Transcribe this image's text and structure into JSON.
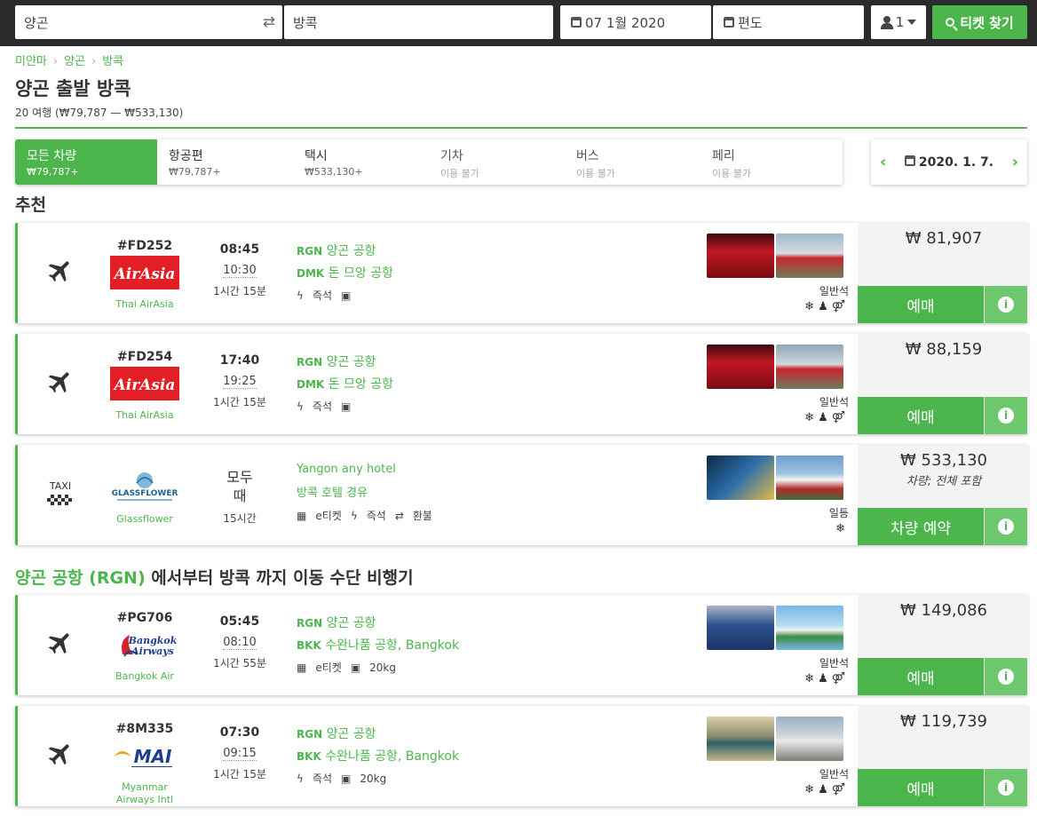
{
  "search": {
    "from": "양곤",
    "to": "방콕",
    "date": "07 1월 2020",
    "trip_type": "편도",
    "passengers": "1",
    "button_label": "티켓 찾기"
  },
  "breadcrumb": [
    "미얀마",
    "양곤",
    "방콕"
  ],
  "page_title": "양곤 출발 방콕",
  "summary": "20 여행 (₩79,787 — ₩533,130)",
  "tabs": [
    {
      "label": "모든 차량",
      "sub": "₩79,787+"
    },
    {
      "label": "항공편",
      "sub": "₩79,787+"
    },
    {
      "label": "택시",
      "sub": "₩533,130+"
    },
    {
      "label": "기차",
      "sub": "이용 불가"
    },
    {
      "label": "버스",
      "sub": "이용 불가"
    },
    {
      "label": "페리",
      "sub": "이용 불가"
    }
  ],
  "date_nav": {
    "date": "2020. 1. 7."
  },
  "sections": {
    "recommended": "추천",
    "flights_prefix": "양곤 공항 (RGN)",
    "flights_suffix": "에서부터 방콕 까지 이동 수단 비행기"
  },
  "results": [
    {
      "code": "#FD252",
      "carrier": "Thai AirAsia",
      "dep": "08:45",
      "arr": "10:30",
      "dur": "1시간 15분",
      "from_code": "RGN",
      "from": "양곤 공항",
      "to_code": "DMK",
      "to": "돈 므앙 공항",
      "feat1": "즉석",
      "feat2": "",
      "seat": "일반석",
      "price": "₩ 81,907",
      "book": "예매"
    },
    {
      "code": "#FD254",
      "carrier": "Thai AirAsia",
      "dep": "17:40",
      "arr": "19:25",
      "dur": "1시간 15분",
      "from_code": "RGN",
      "from": "양곤 공항",
      "to_code": "DMK",
      "to": "돈 므앙 공항",
      "feat1": "즉석",
      "feat2": "",
      "seat": "일반석",
      "price": "₩ 88,159",
      "book": "예매"
    },
    {
      "code": "",
      "carrier": "Glassflower",
      "dep": "모두",
      "dep2": "때",
      "dur": "15시간",
      "taxi_label": "TAXI",
      "from": "Yangon any hotel",
      "to": "방콕 호텔 경유",
      "feat0": "e티켓",
      "feat1": "즉석",
      "feat2": "환불",
      "seat": "일등",
      "price": "₩ 533,130",
      "price_note": "차량; 전체 포함",
      "book": "차량 예약"
    },
    {
      "code": "#PG706",
      "carrier": "Bangkok Air",
      "dep": "05:45",
      "arr": "08:10",
      "dur": "1시간 55분",
      "from_code": "RGN",
      "from": "양곤 공항",
      "to_code": "BKK",
      "to": "수완나품 공항, Bangkok",
      "feat0": "e티켓",
      "feat2": "20kg",
      "seat": "일반석",
      "price": "₩ 149,086",
      "book": "예매"
    },
    {
      "code": "#8M335",
      "carrier": "Myanmar Airways Intl",
      "dep": "07:30",
      "arr": "09:15",
      "dur": "1시간 15분",
      "from_code": "RGN",
      "from": "양곤 공항",
      "to_code": "BKK",
      "to": "수완나품 공항, Bangkok",
      "feat1": "즉석",
      "feat2": "20kg",
      "seat": "일반석",
      "price": "₩ 119,739",
      "book": "예매"
    }
  ],
  "colors": {
    "accent": "#4cb64c",
    "topbar": "#2b2b2b",
    "airasia_red": "#e31e24"
  },
  "icons": [
    "swap-icon",
    "calendar-icon",
    "person-icon",
    "search-icon",
    "plane-icon",
    "taxi-icon",
    "bolt-icon",
    "bag-icon",
    "qr-icon",
    "refund-icon",
    "snowflake-icon",
    "seat-icon",
    "toilet-icon",
    "info-icon"
  ]
}
